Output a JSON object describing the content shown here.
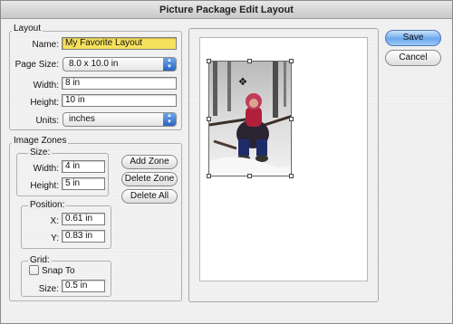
{
  "window": {
    "title": "Picture Package Edit Layout"
  },
  "layout": {
    "group_label": "Layout",
    "name_label": "Name:",
    "name_value": "My Favorite Layout",
    "page_size_label": "Page Size:",
    "page_size_value": "8.0 x 10.0 in",
    "width_label": "Width:",
    "width_value": "8 in",
    "height_label": "Height:",
    "height_value": "10 in",
    "units_label": "Units:",
    "units_value": "inches"
  },
  "image_zones": {
    "group_label": "Image Zones",
    "size_label": "Size:",
    "width_label": "Width:",
    "width_value": "4 in",
    "height_label": "Height:",
    "height_value": "5 in",
    "add_zone": "Add Zone",
    "delete_zone": "Delete Zone",
    "delete_all": "Delete All",
    "position_label": "Position:",
    "x_label": "X:",
    "x_value": "0.61 in",
    "y_label": "Y:",
    "y_value": "0.83 in"
  },
  "grid": {
    "group_label": "Grid:",
    "snap_to_label": "Snap To",
    "snap_to_checked": false,
    "size_label": "Size:",
    "size_value": "0.5 in"
  },
  "buttons": {
    "save": "Save",
    "cancel": "Cancel"
  },
  "preview": {
    "image_alt": "photo-of-child-in-snow",
    "move_icon": "✥"
  },
  "colors": {
    "name_highlight": "#f6e15c",
    "accent": "#6aa6ee"
  }
}
